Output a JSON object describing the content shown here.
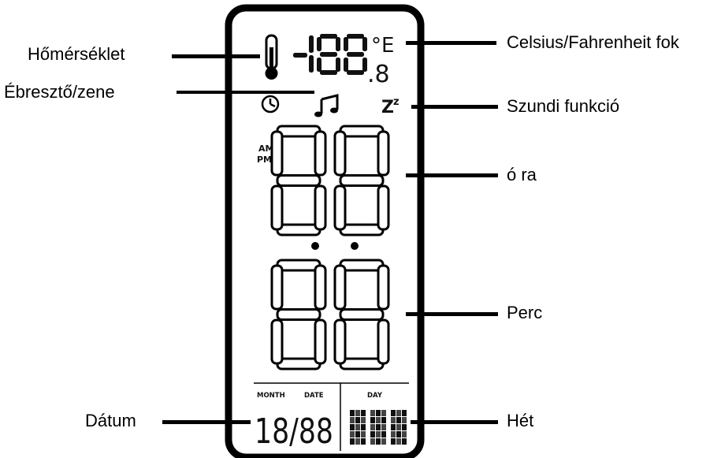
{
  "labels": {
    "temperature": "Hőmérséklet",
    "alarm_music": "Ébresztő/zene",
    "celsius_fahrenheit": "Celsius/Fahrenheit fok",
    "snooze": "Szundi funkció",
    "hour": "ó ra",
    "minute": "Perc",
    "date": "Dátum",
    "week": "Hét"
  },
  "lcd": {
    "temp_unit_top": "°E",
    "temp_decimal": ".8",
    "ampm_am": "AM",
    "ampm_pm": "PM",
    "snooze_symbol": "Z",
    "snooze_superscript": "z",
    "month_label": "MONTH",
    "date_label": "DATE",
    "day_label": "DAY",
    "date_value": "18/88"
  },
  "icons": [
    "thermometer-icon",
    "clock-icon",
    "music-note-icon"
  ]
}
